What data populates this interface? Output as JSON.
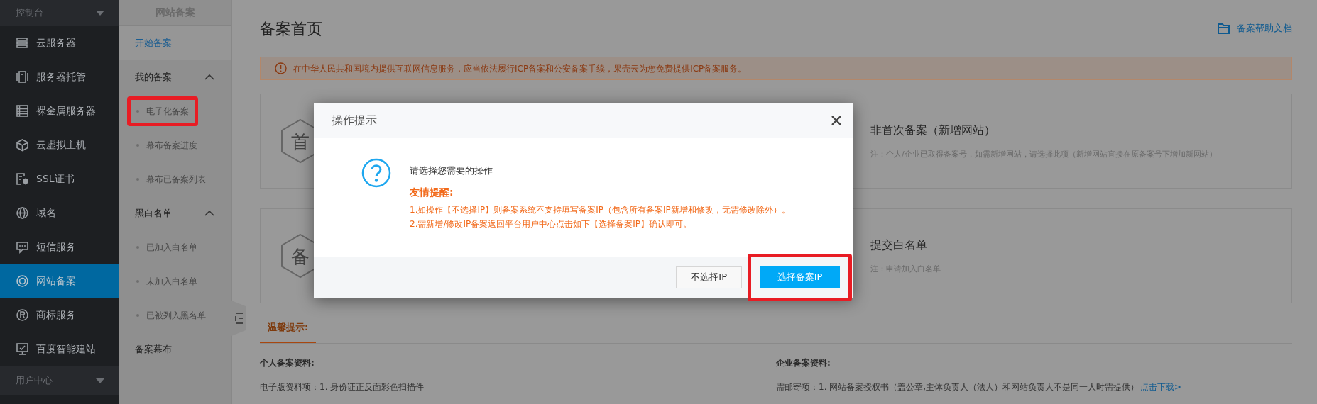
{
  "sidebar": {
    "header": "控制台",
    "items": [
      {
        "label": "云服务器",
        "selected": false
      },
      {
        "label": "服务器托管",
        "selected": false
      },
      {
        "label": "裸金属服务器",
        "selected": false
      },
      {
        "label": "云虚拟主机",
        "selected": false
      },
      {
        "label": "SSL证书",
        "selected": false
      },
      {
        "label": "域名",
        "selected": false
      },
      {
        "label": "短信服务",
        "selected": false
      },
      {
        "label": "网站备案",
        "selected": true
      },
      {
        "label": "商标服务",
        "selected": false
      },
      {
        "label": "百度智能建站",
        "selected": false
      }
    ],
    "footer": "用户中心"
  },
  "subnav": {
    "title": "网站备案",
    "start_link": "开始备案",
    "groups": [
      {
        "label": "我的备案",
        "expanded": true,
        "items": [
          {
            "label": "电子化备案",
            "highlighted": true
          },
          {
            "label": "幕布备案进度",
            "highlighted": false
          },
          {
            "label": "幕布已备案列表",
            "highlighted": false
          }
        ]
      },
      {
        "label": "黑白名单",
        "expanded": true,
        "items": [
          {
            "label": "已加入白名单",
            "highlighted": false
          },
          {
            "label": "未加入白名单",
            "highlighted": false
          },
          {
            "label": "已被列入黑名单",
            "highlighted": false
          }
        ]
      }
    ],
    "bottom_link": "备案幕布"
  },
  "main": {
    "title": "备案首页",
    "help_link": "备案帮助文档",
    "notice": "在中华人民共和国境内提供互联网信息服务，应当依法履行ICP备案和公安备案手续，果壳云为您免费提供ICP备案服务。",
    "cards": [
      {
        "badge": "首"
      },
      {
        "title": "非首次备案（新增网站）",
        "note": "注：个人/企业已取得备案号，如需新增网站，请选择此项（新增网站直接在原备案号下增加新网站）"
      },
      {
        "badge": "备"
      },
      {
        "title": "提交白名单",
        "note": "注：申请加入白名单"
      }
    ],
    "tabs": [
      {
        "label": "温馨提示:",
        "selected": true
      }
    ],
    "materials": [
      {
        "heading": "个人备案资料:",
        "rows": [
          {
            "label": "电子版资料项：",
            "text": "1. 身份证正反面彩色扫描件"
          }
        ]
      },
      {
        "heading": "企业备案资料:",
        "rows": [
          {
            "label": "需邮寄项：",
            "text": "1. 网站备案授权书（盖公章,主体负责人（法人）和网站负责人不是同一人时需提供）",
            "link": "点击下载>"
          }
        ]
      }
    ]
  },
  "modal": {
    "title": "操作提示",
    "prompt": "请选择您需要的操作",
    "reminder_title": "友情提醒:",
    "reminder_lines": [
      "1.如操作【不选择IP】则备案系统不支持填写备案IP（包含所有备案IP新增和修改，无需修改除外）。",
      "2.需新增/修改IP备案返回平台用户中心点击如下【选择备案IP】确认即可。"
    ],
    "buttons": [
      {
        "label": "不选择IP",
        "kind": "default",
        "highlighted": false
      },
      {
        "label": "选择备案IP",
        "kind": "primary",
        "highlighted": true
      }
    ]
  }
}
